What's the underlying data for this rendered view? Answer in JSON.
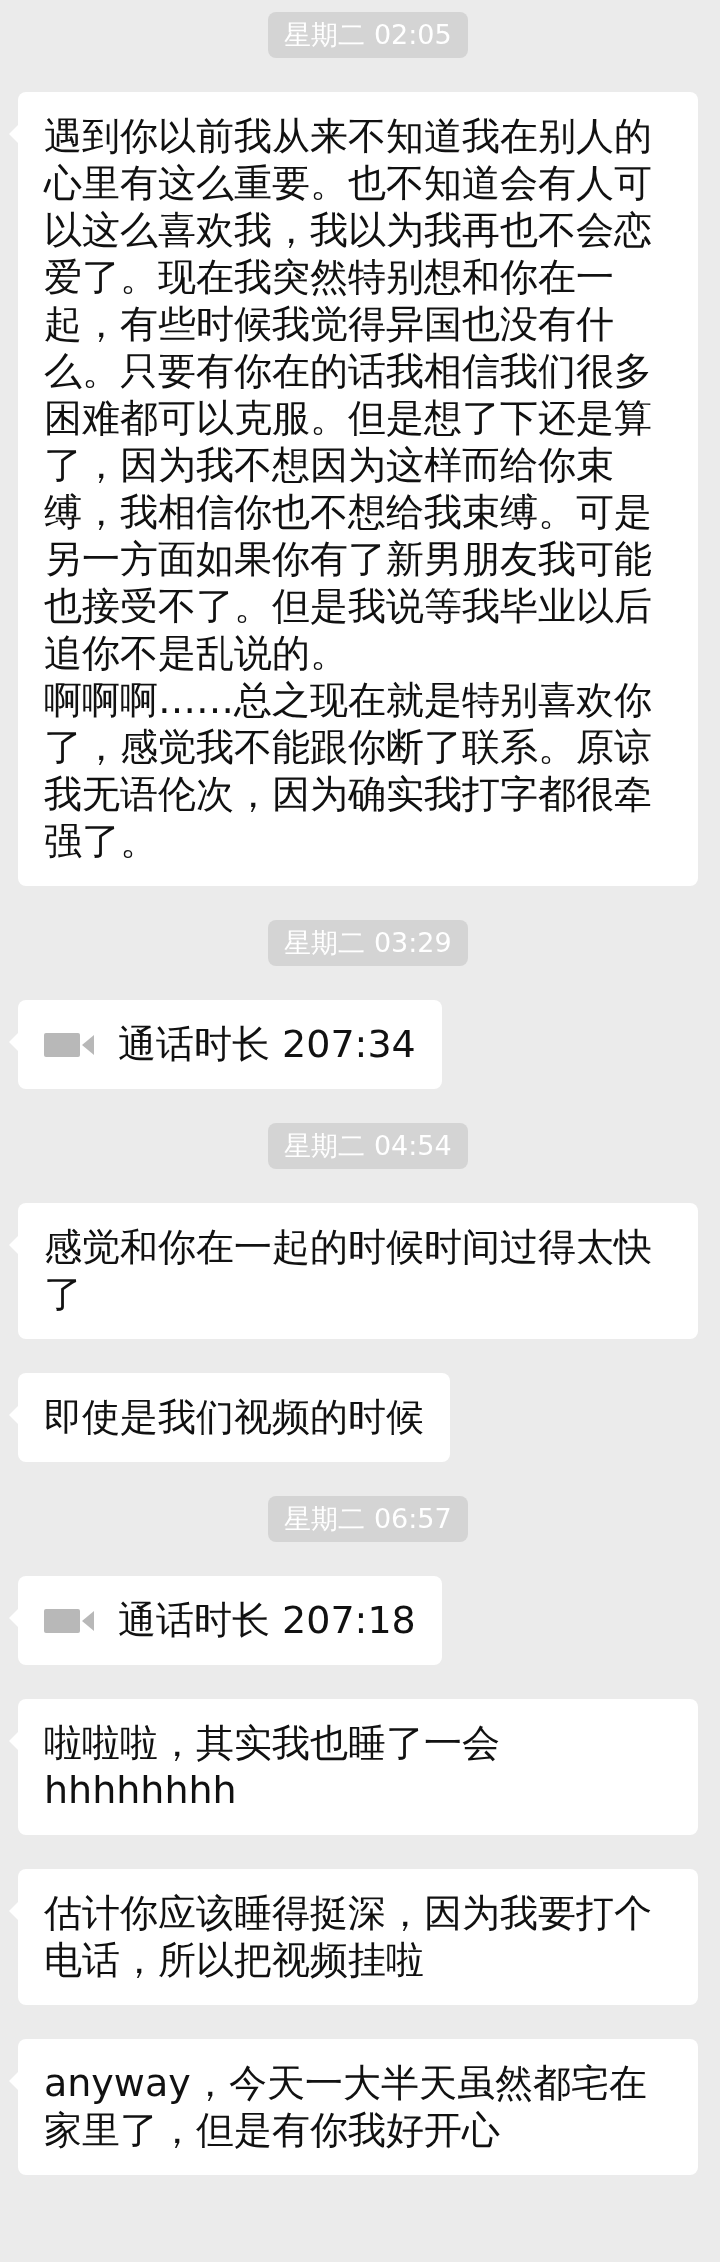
{
  "messages": [
    {
      "kind": "time",
      "text": "星期二 02:05"
    },
    {
      "kind": "text",
      "paragraphs": [
        "遇到你以前我从来不知道我在别人的心里有这么重要。也不知道会有人可以这么喜欢我，我以为我再也不会恋爱了。现在我突然特别想和你在一起，有些时候我觉得异国也没有什么。只要有你在的话我相信我们很多困难都可以克服。但是想了下还是算了，因为我不想因为这样而给你束缚，我相信你也不想给我束缚。可是另一方面如果你有了新男朋友我可能也接受不了。但是我说等我毕业以后追你不是乱说的。",
        "啊啊啊……总之现在就是特别喜欢你了，感觉我不能跟你断了联系。原谅我无语伦次，因为确实我打字都很牵强了。"
      ]
    },
    {
      "kind": "time",
      "text": "星期二 03:29"
    },
    {
      "kind": "call",
      "text": "通话时长 207:34"
    },
    {
      "kind": "time",
      "text": "星期二 04:54"
    },
    {
      "kind": "text",
      "paragraphs": [
        "感觉和你在一起的时候时间过得太快了"
      ]
    },
    {
      "kind": "text",
      "paragraphs": [
        "即使是我们视频的时候"
      ]
    },
    {
      "kind": "time",
      "text": "星期二 06:57"
    },
    {
      "kind": "call",
      "text": "通话时长 207:18"
    },
    {
      "kind": "text",
      "paragraphs": [
        "啦啦啦，其实我也睡了一会hhhhhhhh"
      ]
    },
    {
      "kind": "text",
      "paragraphs": [
        "估计你应该睡得挺深，因为我要打个电话，所以把视频挂啦"
      ]
    },
    {
      "kind": "text",
      "paragraphs": [
        "anyway，今天一大半天虽然都宅在家里了，但是有你我好开心"
      ]
    }
  ]
}
